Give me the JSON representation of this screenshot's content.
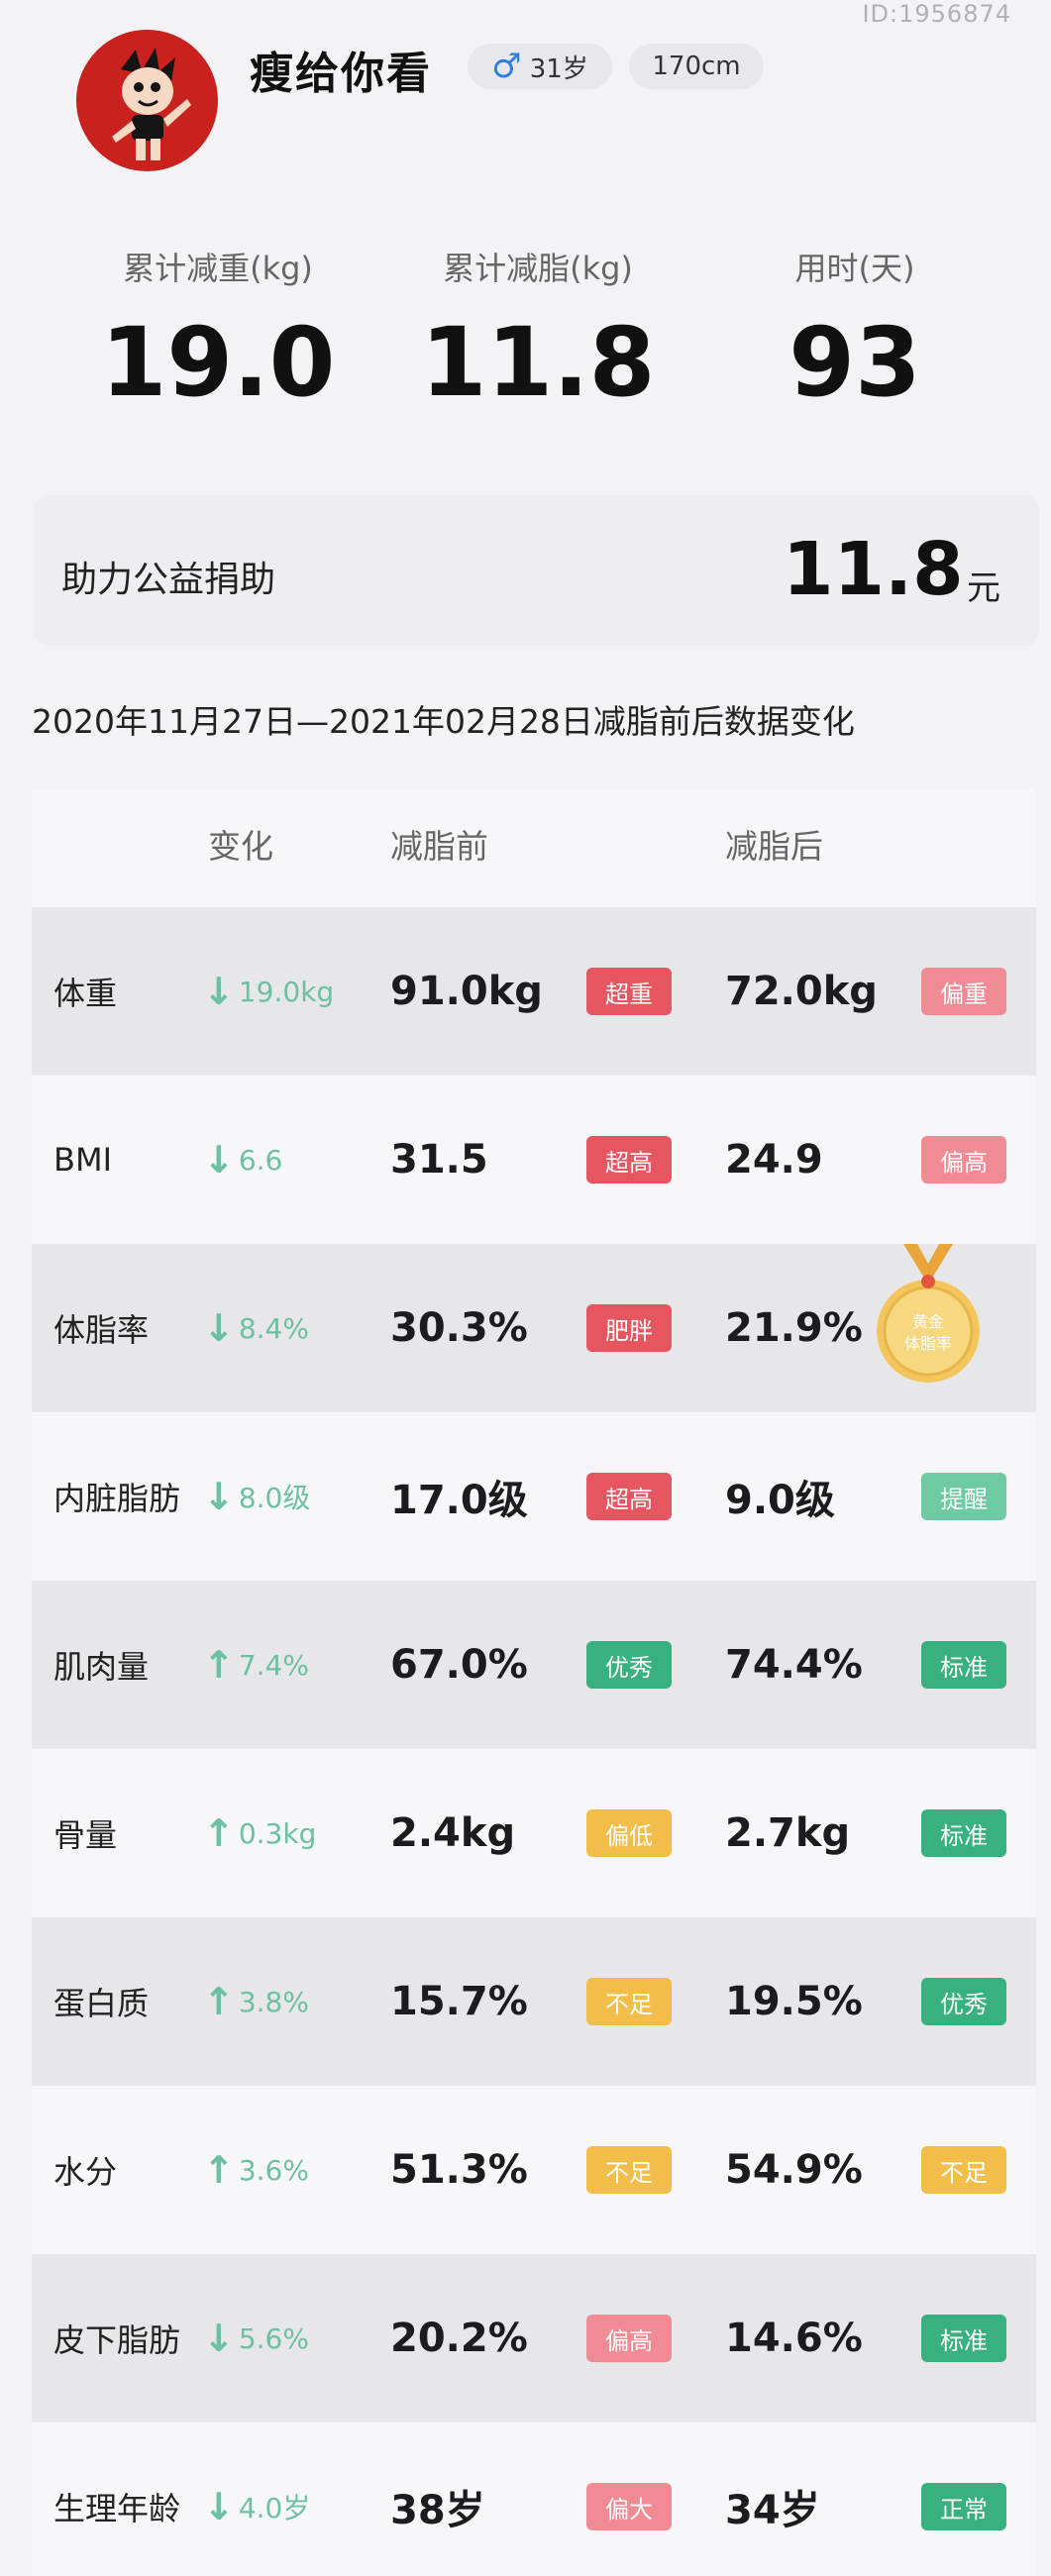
{
  "header": {
    "user_id": "ID:1956874",
    "username": "瘦给你看",
    "gender_icon": "male-icon",
    "age": "31岁",
    "height": "170cm"
  },
  "summary": {
    "total_weight_loss": {
      "label": "累计减重(kg)",
      "value": "19.0"
    },
    "total_fat_loss": {
      "label": "累计减脂(kg)",
      "value": "11.8"
    },
    "days_used": {
      "label": "用时(天)",
      "value": "93"
    }
  },
  "donation": {
    "label": "助力公益捐助",
    "amount": "11.8",
    "unit": "元"
  },
  "date_range": "2020年11月27日—2021年02月28日减脂前后数据变化",
  "table": {
    "headers": {
      "change": "变化",
      "before": "减脂前",
      "after": "减脂后"
    },
    "rows": [
      {
        "name": "体重",
        "dir": "down",
        "arrow": "↓",
        "change": "19.0kg",
        "before": "91.0kg",
        "before_tag": "超重",
        "before_color": "#e55660",
        "after": "72.0kg",
        "after_tag": "偏重",
        "after_color": "#f08a93"
      },
      {
        "name": "BMI",
        "dir": "down",
        "arrow": "↓",
        "change": "6.6",
        "before": "31.5",
        "before_tag": "超高",
        "before_color": "#e55660",
        "after": "24.9",
        "after_tag": "偏高",
        "after_color": "#f08a93"
      },
      {
        "name": "体脂率",
        "dir": "down",
        "arrow": "↓",
        "change": "8.4%",
        "before": "30.3%",
        "before_tag": "肥胖",
        "before_color": "#e55660",
        "after": "21.9%",
        "after_tag": "",
        "after_color": "",
        "medal_text": "黄金\n体脂率"
      },
      {
        "name": "内脏脂肪",
        "dir": "down",
        "arrow": "↓",
        "change": "8.0级",
        "before": "17.0级",
        "before_tag": "超高",
        "before_color": "#e55660",
        "after": "9.0级",
        "after_tag": "提醒",
        "after_color": "#6dcaa2"
      },
      {
        "name": "肌肉量",
        "dir": "up",
        "arrow": "↑",
        "change": "7.4%",
        "before": "67.0%",
        "before_tag": "优秀",
        "before_color": "#39b07f",
        "after": "74.4%",
        "after_tag": "标准",
        "after_color": "#39b07f"
      },
      {
        "name": "骨量",
        "dir": "up",
        "arrow": "↑",
        "change": "0.3kg",
        "before": "2.4kg",
        "before_tag": "偏低",
        "before_color": "#f3bd4a",
        "after": "2.7kg",
        "after_tag": "标准",
        "after_color": "#39b07f"
      },
      {
        "name": "蛋白质",
        "dir": "up",
        "arrow": "↑",
        "change": "3.8%",
        "before": "15.7%",
        "before_tag": "不足",
        "before_color": "#f3bd4a",
        "after": "19.5%",
        "after_tag": "优秀",
        "after_color": "#39b07f"
      },
      {
        "name": "水分",
        "dir": "up",
        "arrow": "↑",
        "change": "3.6%",
        "before": "51.3%",
        "before_tag": "不足",
        "before_color": "#f3bd4a",
        "after": "54.9%",
        "after_tag": "不足",
        "after_color": "#f3bd4a"
      },
      {
        "name": "皮下脂肪",
        "dir": "down",
        "arrow": "↓",
        "change": "5.6%",
        "before": "20.2%",
        "before_tag": "偏高",
        "before_color": "#f08a93",
        "after": "14.6%",
        "after_tag": "标准",
        "after_color": "#39b07f"
      },
      {
        "name": "生理年龄",
        "dir": "down",
        "arrow": "↓",
        "change": "4.0岁",
        "before": "38岁",
        "before_tag": "偏大",
        "before_color": "#f08a93",
        "after": "34岁",
        "after_tag": "正常",
        "after_color": "#39b07f"
      }
    ]
  }
}
